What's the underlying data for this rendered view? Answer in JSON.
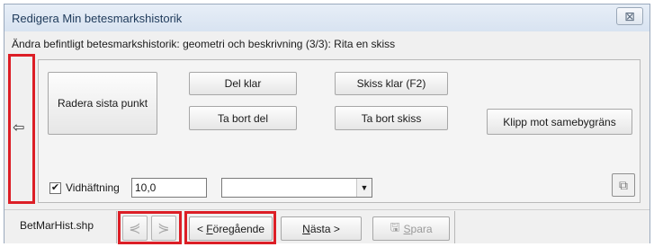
{
  "window": {
    "title": "Redigera Min betesmarkshistorik",
    "close_glyph": "⊠",
    "subtitle": "Ändra befintligt betesmarkshistorik: geometri och beskrivning (3/3): Rita en skiss"
  },
  "toolbar": {
    "collapse_glyph": "⇦",
    "radera_sista_punkt": "Radera sista punkt",
    "del_klar": "Del klar",
    "ta_bort_del": "Ta bort del",
    "skiss_klar": "Skiss klar (F2)",
    "ta_bort_skiss": "Ta bort skiss",
    "klipp_mot_samebygrans": "Klipp mot samebygräns"
  },
  "options": {
    "vidhaftning_checked": true,
    "check_glyph": "✔",
    "vidhaftning_label": "Vidhäftning",
    "vidhaftning_value": "10,0",
    "dropdown_value": "",
    "dropdown_arrow": "▼",
    "export_icon": "⧉"
  },
  "footer": {
    "file_name": "BetMarHist.shp",
    "first_glyph": "⋞",
    "prev_glyph": "⋟",
    "foregaende_prefix": "< ",
    "foregaende_underlined": "F",
    "foregaende_rest": "öregående",
    "nasta_underlined": "N",
    "nasta_rest": "ästa >",
    "spara_icon": "🖫",
    "spara_underlined": "S",
    "spara_rest": "para"
  },
  "colors": {
    "highlight": "#dc1e26",
    "title_text": "#1e3a5a"
  }
}
